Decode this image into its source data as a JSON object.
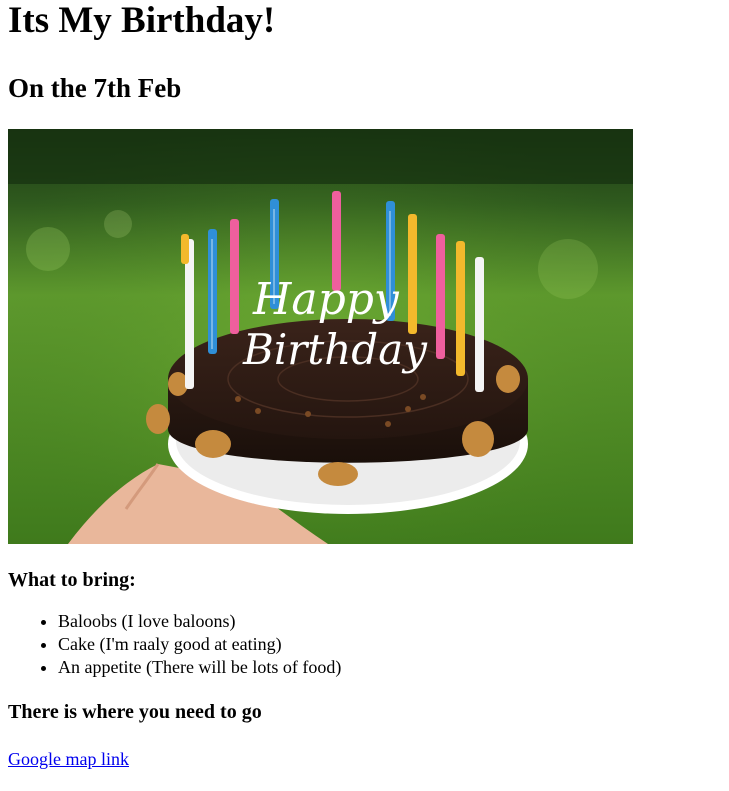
{
  "title": "Its My Birthday!",
  "subtitle": "On the 7th Feb",
  "bring": {
    "heading": "What to bring:",
    "items": [
      "Baloobs (I love baloons)",
      "Cake (I'm raaly good at eating)",
      "An appetite (There will be lots of food)"
    ]
  },
  "location": {
    "heading": "There is where you need to go",
    "link_label": "Google map link"
  },
  "image": {
    "cake_text": [
      "Happy",
      "Birthday"
    ]
  },
  "colors": {
    "link": "#0000ee",
    "text": "#000000"
  }
}
